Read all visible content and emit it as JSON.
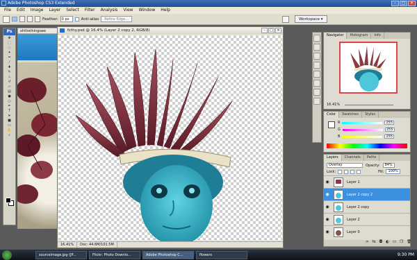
{
  "app": {
    "title": "Adobe Photoshop CS3 Extended",
    "window_buttons": [
      "–",
      "□",
      "✕"
    ]
  },
  "menu": [
    "File",
    "Edit",
    "Image",
    "Layer",
    "Select",
    "Filter",
    "Analysis",
    "View",
    "Window",
    "Help"
  ],
  "options_bar": {
    "feather_label": "Feather:",
    "feather_value": "0 px",
    "antialias_label": "Anti-alias",
    "refine_edge_label": "Refine Edge...",
    "workspace_label": "Workspace ▾"
  },
  "toolbox": {
    "logo": "Ps",
    "tools": [
      "move-tool",
      "marquee-tool",
      "lasso-tool",
      "magic-wand-tool",
      "crop-tool",
      "eyedropper-tool",
      "healing-tool",
      "brush-tool",
      "stamp-tool",
      "history-brush-tool",
      "eraser-tool",
      "gradient-tool",
      "blur-tool",
      "dodge-tool",
      "pen-tool",
      "type-tool",
      "path-select-tool",
      "shape-tool",
      "notes-tool",
      "hand-tool",
      "zoom-tool"
    ]
  },
  "background_doc": {
    "tab": "ohthethingswe"
  },
  "document": {
    "title": "fcthy.psd @ 16.4% (Layer 2 copy 2, RGB/8)",
    "zoom": "16.41%",
    "doc_size": "Doc: 44.6M/101.5M"
  },
  "navigator": {
    "tabs": [
      "Navigator",
      "Histogram",
      "Info"
    ],
    "zoom": "16.41%"
  },
  "color": {
    "tabs": [
      "Color",
      "Swatches",
      "Styles"
    ],
    "r_label": "R",
    "r_value": "255",
    "g_label": "G",
    "g_value": "255",
    "b_label": "B",
    "b_value": "255"
  },
  "layers": {
    "tabs": [
      "Layers",
      "Channels",
      "Paths"
    ],
    "blend_mode": "Overlay",
    "opacity_label": "Opacity:",
    "opacity_value": "84%",
    "lock_label": "Lock:",
    "fill_label": "Fill:",
    "fill_value": "100%",
    "items": [
      {
        "name": "Layer 1"
      },
      {
        "name": "Layer 2 copy 2"
      },
      {
        "name": "Layer 2 copy"
      },
      {
        "name": "Layer 2"
      },
      {
        "name": "Layer 0"
      }
    ]
  },
  "taskbar": {
    "items": [
      "sourceimage.jpg (JP...",
      "Flickr: Photo Downlo...",
      "Adobe Photoshop C...",
      "flowers"
    ],
    "active_index": 2,
    "time": "9:30 PM"
  }
}
